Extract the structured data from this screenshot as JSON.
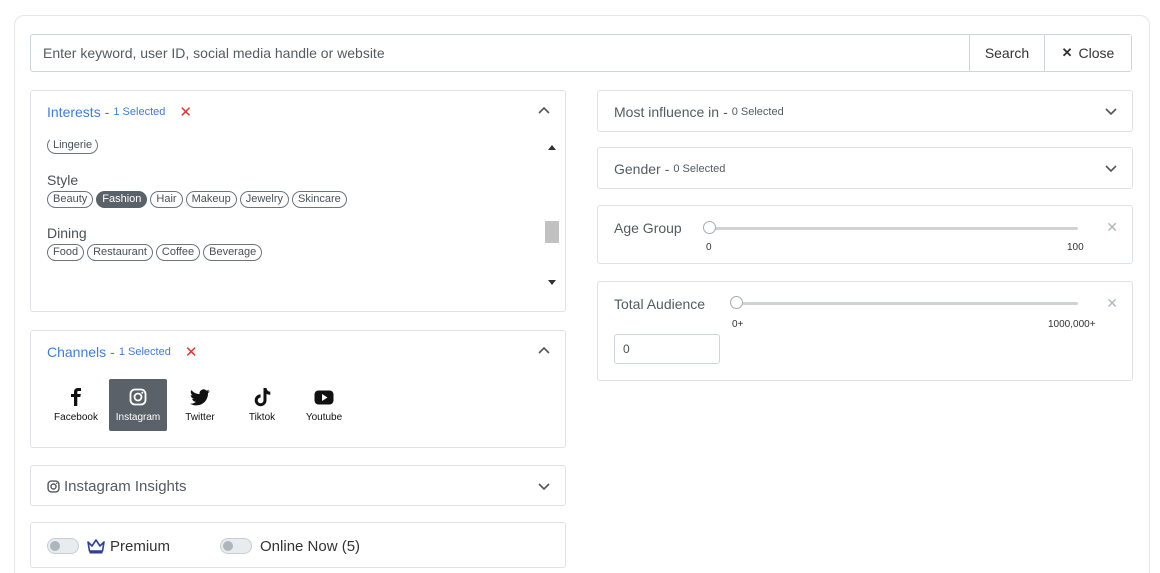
{
  "search": {
    "placeholder": "Enter keyword, user ID, social media handle or website",
    "value": "",
    "search_label": "Search",
    "close_label": "Close"
  },
  "interests": {
    "title": "Interests",
    "selected": "1 Selected",
    "partial_tag": "Lingerie",
    "groups": [
      {
        "title": "Style",
        "tags": [
          "Beauty",
          "Fashion",
          "Hair",
          "Makeup",
          "Jewelry",
          "Skincare"
        ],
        "active": "Fashion"
      },
      {
        "title": "Dining",
        "tags": [
          "Food",
          "Restaurant",
          "Coffee",
          "Beverage"
        ]
      }
    ]
  },
  "channels": {
    "title": "Channels",
    "selected": "1 Selected",
    "items": [
      {
        "label": "Facebook",
        "icon": "facebook-icon"
      },
      {
        "label": "Instagram",
        "icon": "instagram-icon",
        "active": true
      },
      {
        "label": "Twitter",
        "icon": "twitter-icon"
      },
      {
        "label": "Tiktok",
        "icon": "tiktok-icon"
      },
      {
        "label": "Youtube",
        "icon": "youtube-icon"
      }
    ]
  },
  "insights": {
    "title": "Instagram Insights"
  },
  "toggles": {
    "premium": "Premium",
    "online": "Online Now (5)"
  },
  "influence": {
    "title": "Most influence in",
    "selected": "0 Selected"
  },
  "gender": {
    "title": "Gender",
    "selected": "0 Selected"
  },
  "age": {
    "title": "Age Group",
    "min": "0",
    "max": "100",
    "value": 0
  },
  "audience": {
    "title": "Total Audience",
    "min": "0+",
    "max": "1000,000+",
    "value": 0,
    "input_value": "0"
  },
  "colors": {
    "accent": "#3d7edc",
    "danger": "#e3342f",
    "active_bg": "#5a6169"
  }
}
